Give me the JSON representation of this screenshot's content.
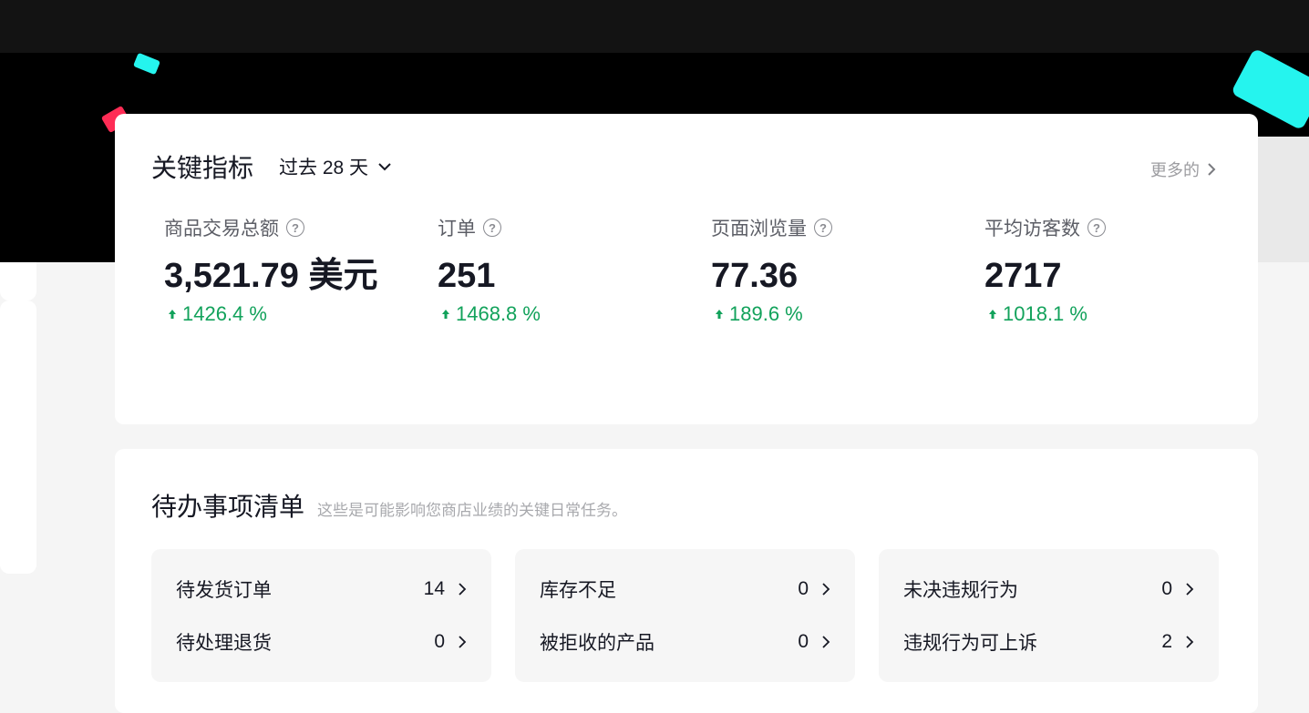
{
  "metrics": {
    "title": "关键指标",
    "range_label": "过去 28 天",
    "more_label": "更多的",
    "items": [
      {
        "label": "商品交易总额",
        "value": "3,521.79 美元",
        "change": "1426.4 %"
      },
      {
        "label": "订单",
        "value": "251",
        "change": "1468.8 %"
      },
      {
        "label": "页面浏览量",
        "value": "77.36",
        "change": "189.6 %"
      },
      {
        "label": "平均访客数",
        "value": "2717",
        "change": "1018.1 %"
      }
    ]
  },
  "todo": {
    "title": "待办事项清单",
    "subtitle": "这些是可能影响您商店业绩的关键日常任务。",
    "groups": [
      {
        "rows": [
          {
            "label": "待发货订单",
            "count": "14"
          },
          {
            "label": "待处理退货",
            "count": "0"
          }
        ]
      },
      {
        "rows": [
          {
            "label": "库存不足",
            "count": "0"
          },
          {
            "label": "被拒收的产品",
            "count": "0"
          }
        ]
      },
      {
        "rows": [
          {
            "label": "未决违规行为",
            "count": "0"
          },
          {
            "label": "违规行为可上诉",
            "count": "2"
          }
        ]
      }
    ]
  },
  "colors": {
    "accent_cyan": "#25f4ee",
    "accent_red": "#fe2c55",
    "positive": "#12a25b"
  }
}
